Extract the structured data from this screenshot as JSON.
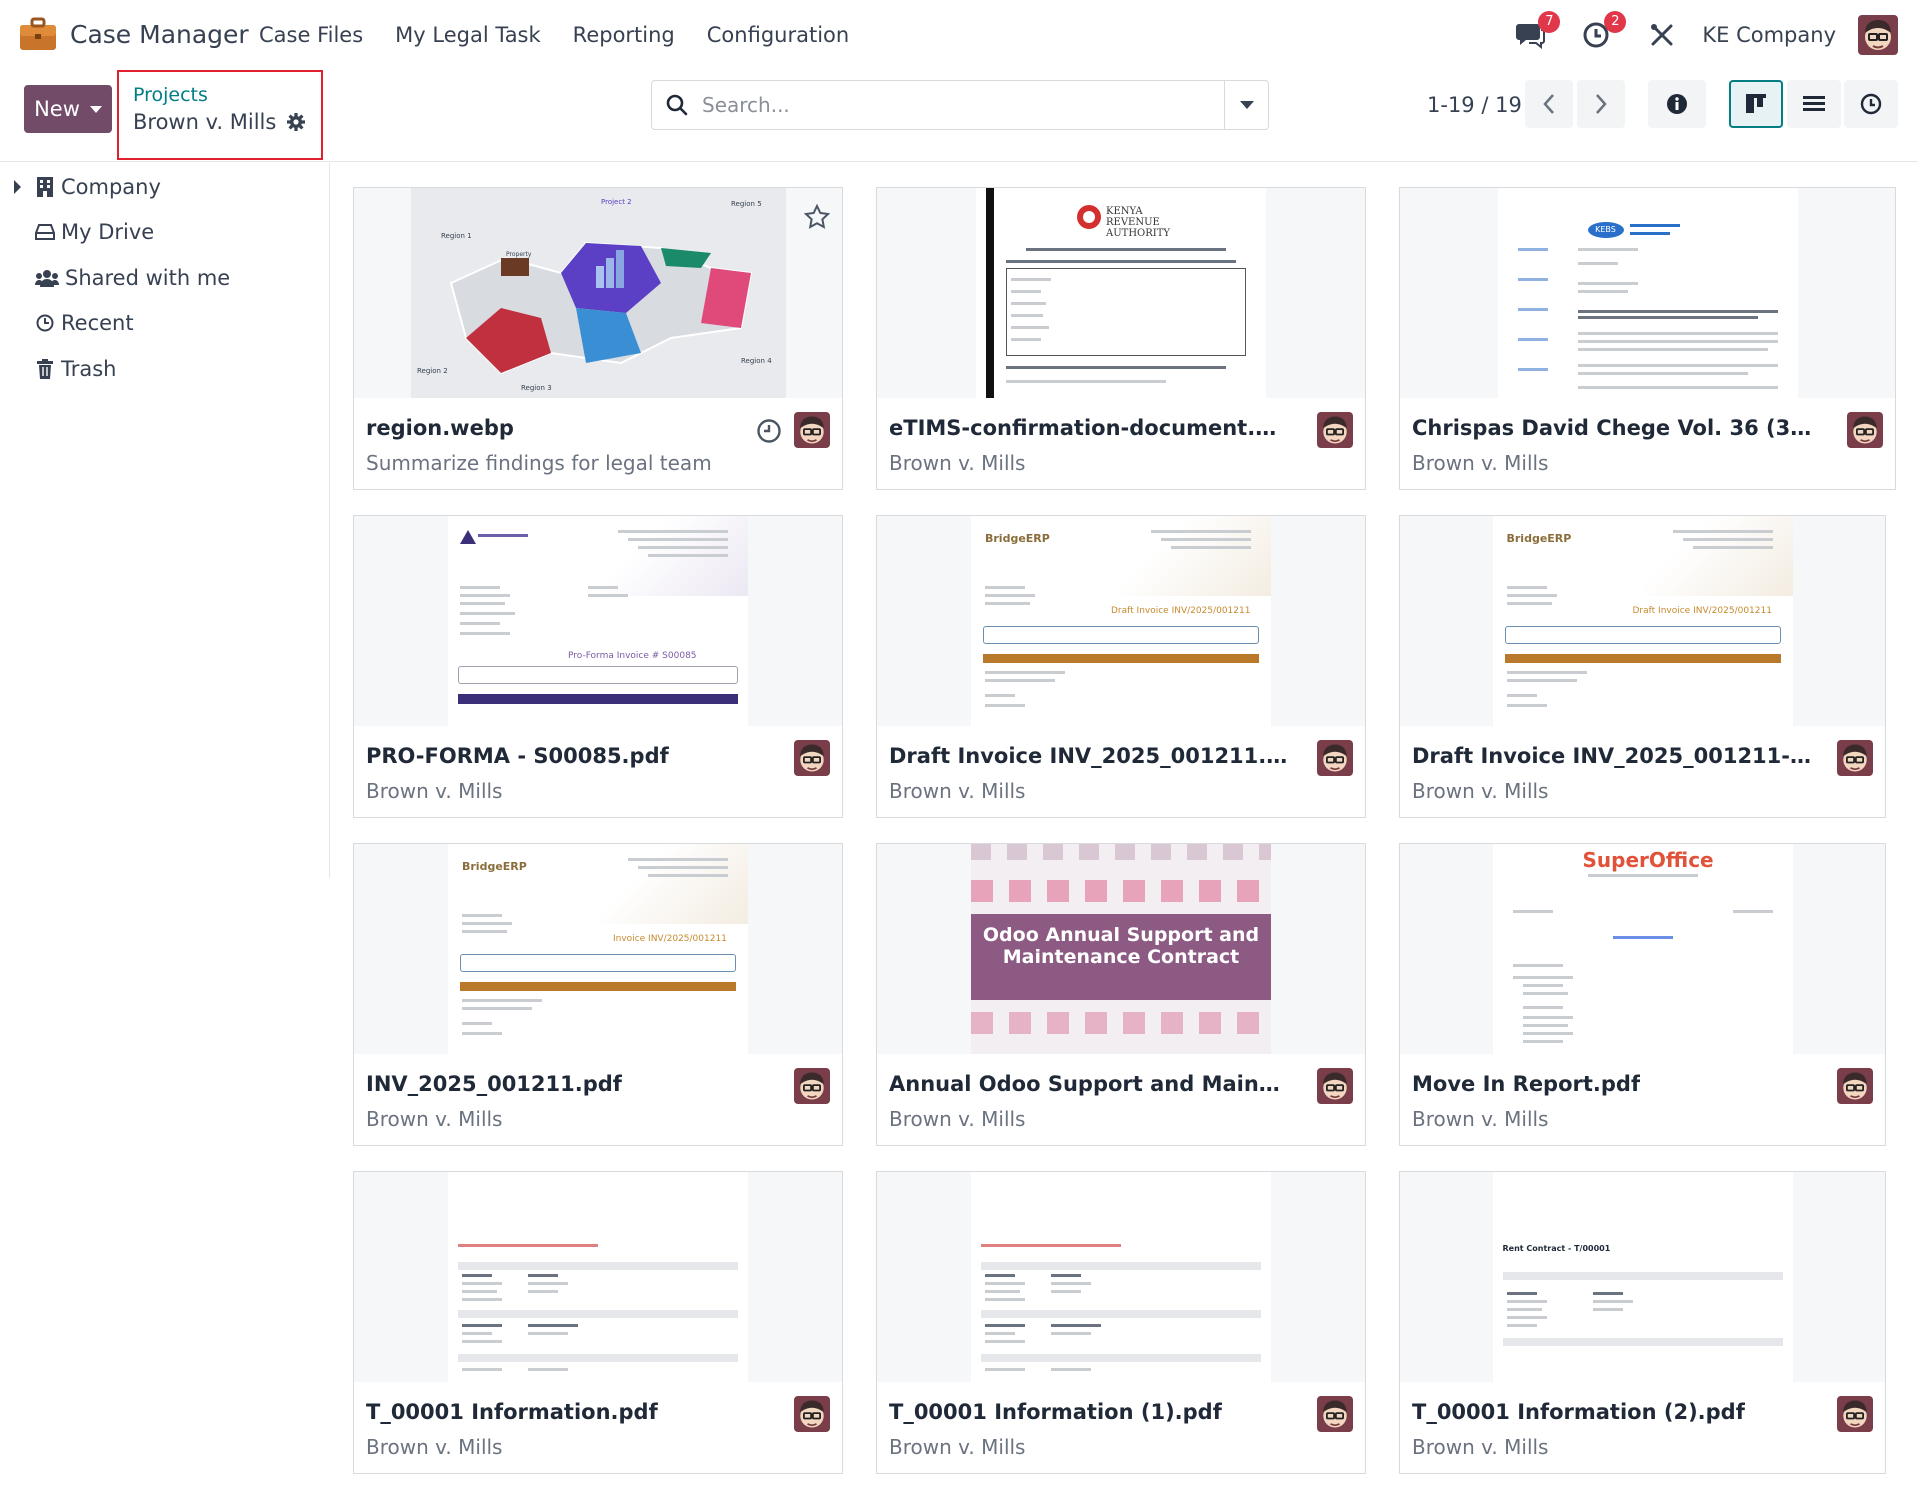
{
  "navbar": {
    "app_name": "Case Manager",
    "menu": [
      "Case Files",
      "My Legal Task",
      "Reporting",
      "Configuration"
    ],
    "messages_count": "7",
    "activities_count": "2",
    "company": "KE Company"
  },
  "control_panel": {
    "new_label": "New",
    "breadcrumb_parent": "Projects",
    "breadcrumb_current": "Brown v. Mills",
    "search_placeholder": "Search...",
    "pager": "1-19 / 19"
  },
  "sidebar": {
    "items": [
      {
        "label": "Company",
        "icon": "building-icon"
      },
      {
        "label": "My Drive",
        "icon": "drive-icon"
      },
      {
        "label": "Shared with me",
        "icon": "users-icon"
      },
      {
        "label": "Recent",
        "icon": "clock-icon"
      },
      {
        "label": "Trash",
        "icon": "trash-icon"
      }
    ]
  },
  "documents": [
    {
      "name": "region.webp",
      "subtitle": "Summarize findings for legal team"
    },
    {
      "name": "eTIMS-confirmation-document.pdf",
      "subtitle": "Brown v. Mills"
    },
    {
      "name": "Chrispas David Chege Vol. 36 (36).pdf",
      "subtitle": "Brown v. Mills"
    },
    {
      "name": "PRO-FORMA - S00085.pdf",
      "subtitle": "Brown v. Mills"
    },
    {
      "name": "Draft Invoice INV_2025_001211.pdf",
      "subtitle": "Brown v. Mills"
    },
    {
      "name": "Draft Invoice INV_2025_001211-1....",
      "subtitle": "Brown v. Mills"
    },
    {
      "name": "INV_2025_001211.pdf",
      "subtitle": "Brown v. Mills"
    },
    {
      "name": "Annual Odoo Support and Mainten...",
      "subtitle": "Brown v. Mills"
    },
    {
      "name": "Move In Report.pdf",
      "subtitle": "Brown v. Mills"
    },
    {
      "name": "T_00001 Information.pdf",
      "subtitle": "Brown v. Mills"
    },
    {
      "name": "T_00001 Information (1).pdf",
      "subtitle": "Brown v. Mills"
    },
    {
      "name": "T_00001 Information (2).pdf",
      "subtitle": "Brown v. Mills"
    }
  ],
  "previews": {
    "map_regions": [
      "Region 1",
      "Region 2",
      "Region 3",
      "Region 4",
      "Region 5",
      "Project 2",
      "Property"
    ],
    "kra_header": "KENYA REVENUE AUTHORITY",
    "kebs_logo": "KEBS",
    "bridge_logo": "BridgeERP",
    "proforma_label": "Pro-Forma Invoice # S00085",
    "draft_label": "Draft Invoice INV/2025/001211",
    "invoice_label": "Invoice INV/2025/001211",
    "odoo_banner": "Odoo Annual Support and Maintenance Contract",
    "superoffice_logo": "SuperOffice",
    "rent_contract": "Rent Contract - T/00001"
  },
  "colors": {
    "brand": "#714b67",
    "link": "#017e84",
    "badge": "#e0374b",
    "highlight_box": "#e0202c"
  }
}
